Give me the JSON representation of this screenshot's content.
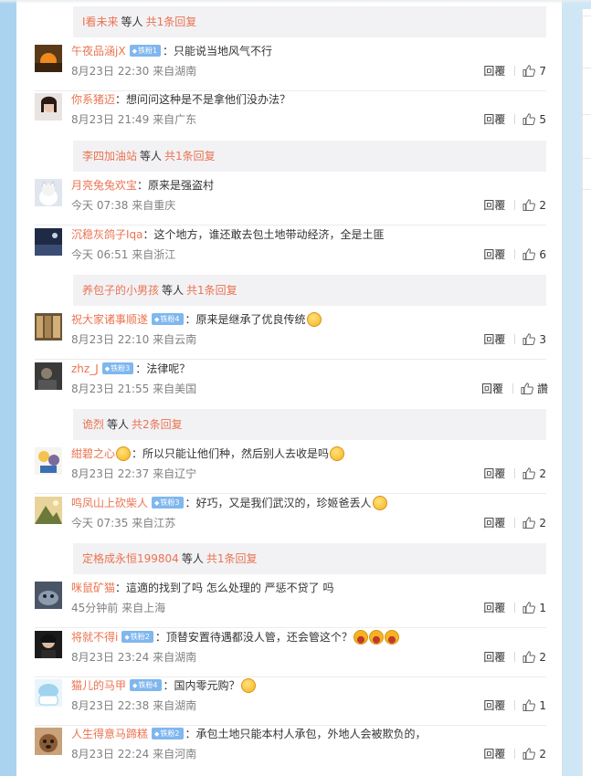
{
  "reply_bars": [
    {
      "name": "I看未来",
      "mid": "等人",
      "count": "共1条回复"
    },
    {
      "name": "李四加油站",
      "mid": "等人",
      "count": "共1条回复"
    },
    {
      "name": "养包子的小男孩",
      "mid": "等人",
      "count": "共1条回复"
    },
    {
      "name": "诡烈",
      "mid": "等人",
      "count": "共2条回复"
    },
    {
      "name": "定格成永恒199804",
      "mid": "等人",
      "count": "共1条回复"
    }
  ],
  "comments": [
    {
      "user": "午夜品涵jX",
      "badge": "铁粉1",
      "text": "：只能说当地风气不行",
      "time": "8月23日 22:30",
      "source": "来自湖南",
      "reply": "回覆",
      "likes": "7"
    },
    {
      "user": "你系猪迈",
      "badge": "",
      "text": "：想问问这种是不是拿他们没办法？",
      "time": "8月23日 21:49",
      "source": "来自广东",
      "reply": "回覆",
      "likes": "5"
    },
    {
      "user": "月亮兔兔欢宝",
      "badge": "",
      "text": "：原来是强盗村",
      "time": "今天 07:38",
      "source": "来自重庆",
      "reply": "回覆",
      "likes": "2"
    },
    {
      "user": "沉稳灰鸽子Iqa",
      "badge": "",
      "text": "：这个地方，谁还敢去包土地带动经济，全是土匪",
      "time": "今天 06:51",
      "source": "来自浙江",
      "reply": "回覆",
      "likes": "6"
    },
    {
      "user": "祝大家诸事顺遂",
      "badge": "铁粉4",
      "text": "：原来是继承了优良传统",
      "time": "8月23日 22:10",
      "source": "来自云南",
      "reply": "回覆",
      "likes": "3"
    },
    {
      "user": "zhz_J",
      "badge": "铁粉3",
      "text": "：法律呢？",
      "time": "8月23日 21:55",
      "source": "来自美国",
      "reply": "回覆",
      "likes": "讚"
    },
    {
      "user": "紺碧之心",
      "badge": "",
      "text": "：所以只能让他们种，然后别人去收是吗",
      "time": "8月23日 22:37",
      "source": "来自辽宁",
      "reply": "回覆",
      "likes": "2"
    },
    {
      "user": "鸣凤山上砍柴人",
      "badge": "铁粉3",
      "text": "：好巧，又是我们武汉的，珍姬爸丢人",
      "time": "今天 07:35",
      "source": "来自江苏",
      "reply": "回覆",
      "likes": "2"
    },
    {
      "user": "咪鼠矿猫",
      "badge": "",
      "text": "：這適的找到了吗 怎么处理的 严惩不贷了 吗",
      "time": "45分钟前",
      "source": "来自上海",
      "reply": "回覆",
      "likes": "1"
    },
    {
      "user": "将就不得i",
      "badge": "铁粉2",
      "text": "：顶替安置待遇都没人管，还会管这个？",
      "time": "8月23日 23:24",
      "source": "来自湖南",
      "reply": "回覆",
      "likes": "2"
    },
    {
      "user": "猫儿的马甲",
      "badge": "铁粉4",
      "text": "：国内零元购？",
      "time": "8月23日 22:38",
      "source": "来自湖南",
      "reply": "回覆",
      "likes": "1"
    },
    {
      "user": "人生得意马蹄糕",
      "badge": "铁粉2",
      "text": "：承包土地只能本村人承包，外地人会被欺负的，",
      "time": "8月23日 22:24",
      "source": "来自河南",
      "reply": "回覆",
      "likes": "2"
    }
  ],
  "colors": {
    "link": "#eb7350",
    "badge": "#7fb7ee",
    "bar_bg": "#f2f2f5",
    "page_bg": "#cfe6f4"
  }
}
